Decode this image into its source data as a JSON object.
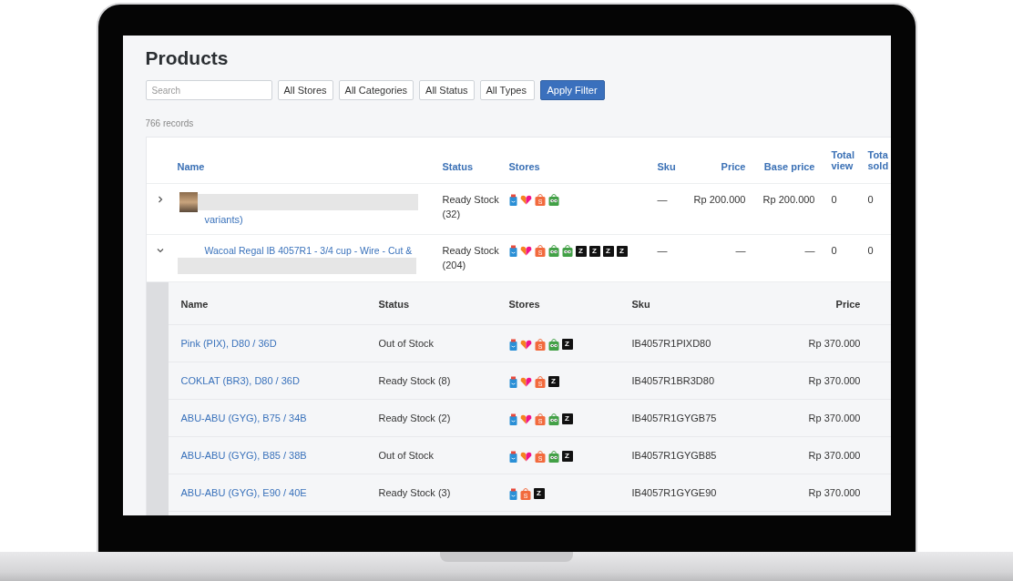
{
  "page": {
    "title": "Products"
  },
  "filters": {
    "search": {
      "placeholder": "Search"
    },
    "selects": [
      "All Stores",
      "All Categories",
      "All Status",
      "All Types"
    ],
    "apply_button": "Apply Filter"
  },
  "record_count": "766 records",
  "table": {
    "columns": [
      "Name",
      "Status",
      "Stores",
      "Sku",
      "Price",
      "Base price",
      "Total view",
      "Tota sold"
    ],
    "rows": [
      {
        "expanded": false,
        "kind": "redacted-above",
        "thumbnail": true,
        "name": "variants)",
        "status": "Ready Stock (32)",
        "stores": [
          {
            "kind": "blibli"
          },
          {
            "kind": "lazada"
          },
          {
            "kind": "shopee",
            "glyph": "S"
          },
          {
            "kind": "tokopedia"
          }
        ],
        "sku": "—",
        "price": "Rp 200.000",
        "base_price": "Rp 200.000",
        "total_view": "0",
        "total_sold": "0"
      },
      {
        "expanded": true,
        "kind": "redacted-below",
        "thumbnail": false,
        "name": "Wacoal Regal IB 4057R1 - 3/4 cup - Wire - Cut &",
        "status": "Ready Stock (204)",
        "stores": [
          {
            "kind": "blibli"
          },
          {
            "kind": "lazada"
          },
          {
            "kind": "shopee",
            "glyph": "S"
          },
          {
            "kind": "tokopedia"
          },
          {
            "kind": "tokopedia"
          },
          {
            "kind": "zalora",
            "glyph": "Z"
          },
          {
            "kind": "zalora",
            "glyph": "Z"
          },
          {
            "kind": "zalora",
            "glyph": "Z"
          },
          {
            "kind": "zalora",
            "glyph": "Z"
          }
        ],
        "sku": "—",
        "price": "—",
        "base_price": "—",
        "total_view": "0",
        "total_sold": "0",
        "variants": {
          "columns": [
            "Name",
            "Status",
            "Stores",
            "Sku",
            "Price"
          ],
          "rows": [
            {
              "name": "Pink (PIX), D80 / 36D",
              "status": "Out of Stock",
              "stores": [
                {
                  "kind": "blibli"
                },
                {
                  "kind": "lazada"
                },
                {
                  "kind": "shopee",
                  "glyph": "S"
                },
                {
                  "kind": "tokopedia"
                },
                {
                  "kind": "zalora",
                  "glyph": "Z"
                }
              ],
              "sku": "IB4057R1PIXD80",
              "price": "Rp 370.000"
            },
            {
              "name": "COKLAT (BR3), D80 / 36D",
              "status": "Ready Stock (8)",
              "stores": [
                {
                  "kind": "blibli"
                },
                {
                  "kind": "lazada"
                },
                {
                  "kind": "shopee",
                  "glyph": "S"
                },
                {
                  "kind": "zalora",
                  "glyph": "Z"
                }
              ],
              "sku": "IB4057R1BR3D80",
              "price": "Rp 370.000"
            },
            {
              "name": "ABU-ABU (GYG), B75 / 34B",
              "status": "Ready Stock (2)",
              "stores": [
                {
                  "kind": "blibli"
                },
                {
                  "kind": "lazada"
                },
                {
                  "kind": "shopee",
                  "glyph": "S"
                },
                {
                  "kind": "tokopedia"
                },
                {
                  "kind": "zalora",
                  "glyph": "Z"
                }
              ],
              "sku": "IB4057R1GYGB75",
              "price": "Rp 370.000"
            },
            {
              "name": "ABU-ABU (GYG), B85 / 38B",
              "status": "Out of Stock",
              "stores": [
                {
                  "kind": "blibli"
                },
                {
                  "kind": "lazada"
                },
                {
                  "kind": "shopee",
                  "glyph": "S"
                },
                {
                  "kind": "tokopedia"
                },
                {
                  "kind": "zalora",
                  "glyph": "Z"
                }
              ],
              "sku": "IB4057R1GYGB85",
              "price": "Rp 370.000"
            },
            {
              "name": "ABU-ABU (GYG), E90 / 40E",
              "status": "Ready Stock (3)",
              "stores": [
                {
                  "kind": "blibli"
                },
                {
                  "kind": "shopee",
                  "glyph": "S"
                },
                {
                  "kind": "zalora",
                  "glyph": "Z"
                }
              ],
              "sku": "IB4057R1GYGE90",
              "price": "Rp 370.000"
            }
          ]
        }
      }
    ]
  }
}
